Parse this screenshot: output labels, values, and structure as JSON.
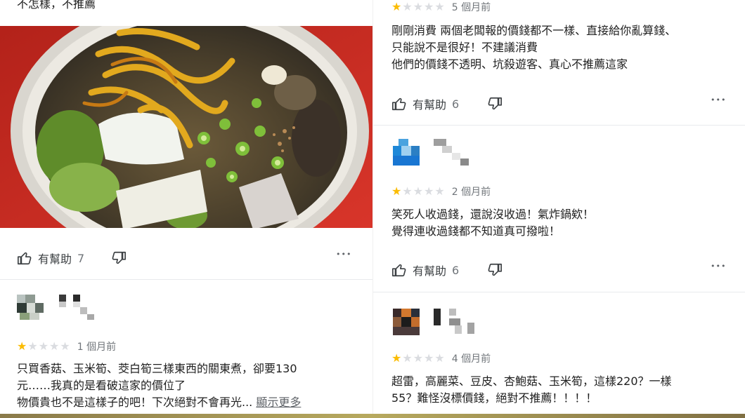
{
  "left": {
    "top_snippet": "不怎樣，不推薦",
    "helpful": {
      "label": "有幫助",
      "count": "7"
    },
    "review2": {
      "rating": 1,
      "date": "1 個月前",
      "lines": [
        "只買香菇、玉米筍、茭白筍三樣東西的關東煮，卻要130",
        "元……我真的是看破這家的價位了",
        "物價貴也不是這樣子的吧！下次絕對不會再光..."
      ],
      "show_more": "顯示更多"
    }
  },
  "right": {
    "review1": {
      "rating": 1,
      "date": "5 個月前",
      "lines": [
        "剛剛消費 兩個老闆報的價錢都不一樣、直接給你亂算錢、",
        "只能說不是很好！不建議消費",
        "他們的價錢不透明、坑殺遊客、真心不推薦這家"
      ],
      "helpful": {
        "label": "有幫助",
        "count": "6"
      }
    },
    "review2": {
      "rating": 1,
      "date": "2 個月前",
      "lines": [
        "笑死人收過錢，還說沒收過！氣炸鍋欸！",
        "覺得連收過錢都不知道真可撥啦！"
      ],
      "helpful": {
        "label": "有幫助",
        "count": "6"
      }
    },
    "review3": {
      "rating": 1,
      "date": "4 個月前",
      "lines": [
        "超雷，高麗菜、豆皮、杏鮑菇、玉米筍，這樣220？一樣",
        "55？難怪沒標價錢，絕對不推薦！！！！"
      ]
    }
  },
  "icons": {
    "thumbs_up": "thumbs-up-icon",
    "thumbs_down": "thumbs-down-icon",
    "more": "more-horizontal-icon"
  },
  "colors": {
    "star_on": "#fbbc04",
    "star_off": "#dadce0",
    "meta_gray": "#70757a",
    "text": "#1f1f1f"
  },
  "more_glyph": "•••"
}
